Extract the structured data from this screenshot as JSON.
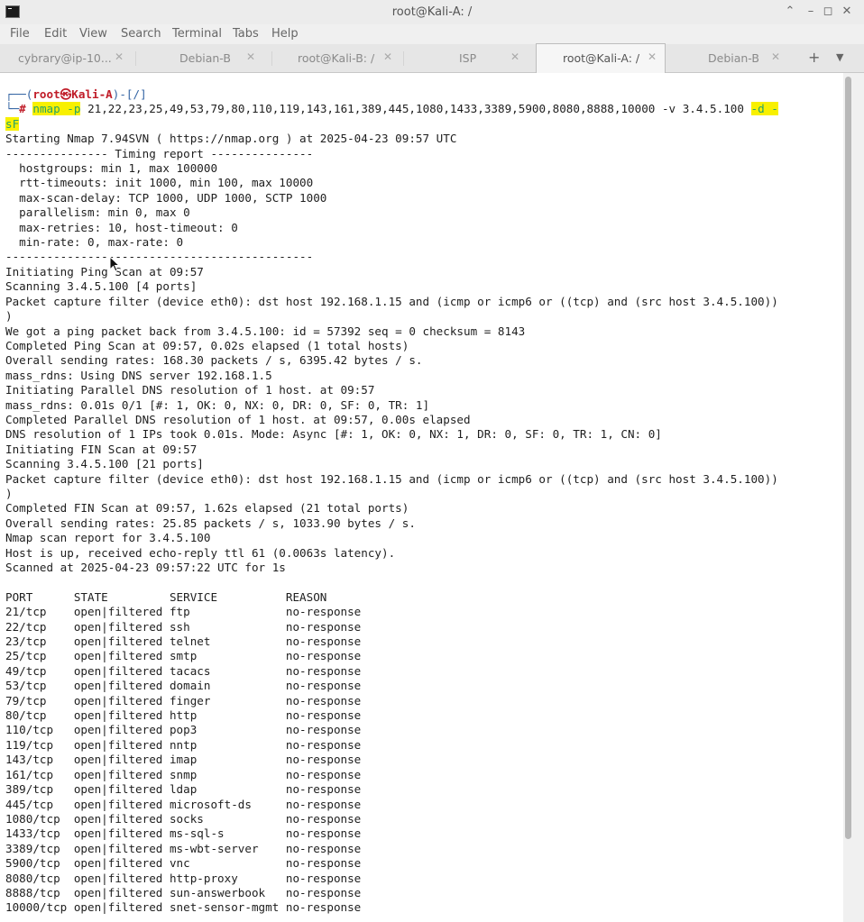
{
  "window": {
    "title": "root@Kali-A: /"
  },
  "menu": [
    "File",
    "Edit",
    "View",
    "Search",
    "Terminal",
    "Tabs",
    "Help"
  ],
  "tabs": [
    {
      "label": "cybrary@ip-10...",
      "active": false
    },
    {
      "label": "Debian-B",
      "active": false
    },
    {
      "label": "root@Kali-B: /",
      "active": false
    },
    {
      "label": "ISP",
      "active": false
    },
    {
      "label": "root@Kali-A: /",
      "active": true
    },
    {
      "label": "Debian-B",
      "active": false
    }
  ],
  "terminal": {
    "prompt": {
      "line1_prefix": "┌──(",
      "user_host": "root㉿Kali-A",
      "line1_suffix": ")-[/]",
      "line2_prefix": "└─",
      "hash": "#",
      "cmd_name": "nmap",
      "cmd_flag": "-p",
      "cmd_args": "21,22,23,25,49,53,79,80,110,119,143,161,389,445,1080,1433,3389,5900,8080,8888,10000 -v 3.4.5.100",
      "cmd_tail1": "-d -",
      "cmd_tail2": "sF"
    },
    "output": "Starting Nmap 7.94SVN ( https://nmap.org ) at 2025-04-23 09:57 UTC\n--------------- Timing report ---------------\n  hostgroups: min 1, max 100000\n  rtt-timeouts: init 1000, min 100, max 10000\n  max-scan-delay: TCP 1000, UDP 1000, SCTP 1000\n  parallelism: min 0, max 0\n  max-retries: 10, host-timeout: 0\n  min-rate: 0, max-rate: 0\n---------------------------------------------\nInitiating Ping Scan at 09:57\nScanning 3.4.5.100 [4 ports]\nPacket capture filter (device eth0): dst host 192.168.1.15 and (icmp or icmp6 or ((tcp) and (src host 3.4.5.100))\n)\nWe got a ping packet back from 3.4.5.100: id = 57392 seq = 0 checksum = 8143\nCompleted Ping Scan at 09:57, 0.02s elapsed (1 total hosts)\nOverall sending rates: 168.30 packets / s, 6395.42 bytes / s.\nmass_rdns: Using DNS server 192.168.1.5\nInitiating Parallel DNS resolution of 1 host. at 09:57\nmass_rdns: 0.01s 0/1 [#: 1, OK: 0, NX: 0, DR: 0, SF: 0, TR: 1]\nCompleted Parallel DNS resolution of 1 host. at 09:57, 0.00s elapsed\nDNS resolution of 1 IPs took 0.01s. Mode: Async [#: 1, OK: 0, NX: 1, DR: 0, SF: 0, TR: 1, CN: 0]\nInitiating FIN Scan at 09:57\nScanning 3.4.5.100 [21 ports]\nPacket capture filter (device eth0): dst host 192.168.1.15 and (icmp or icmp6 or ((tcp) and (src host 3.4.5.100))\n)\nCompleted FIN Scan at 09:57, 1.62s elapsed (21 total ports)\nOverall sending rates: 25.85 packets / s, 1033.90 bytes / s.\nNmap scan report for 3.4.5.100\nHost is up, received echo-reply ttl 61 (0.0063s latency).\nScanned at 2025-04-23 09:57:22 UTC for 1s\n\nPORT      STATE         SERVICE          REASON\n21/tcp    open|filtered ftp              no-response\n22/tcp    open|filtered ssh              no-response\n23/tcp    open|filtered telnet           no-response\n25/tcp    open|filtered smtp             no-response\n49/tcp    open|filtered tacacs           no-response\n53/tcp    open|filtered domain           no-response\n79/tcp    open|filtered finger           no-response\n80/tcp    open|filtered http             no-response\n110/tcp   open|filtered pop3             no-response\n119/tcp   open|filtered nntp             no-response\n143/tcp   open|filtered imap             no-response\n161/tcp   open|filtered snmp             no-response\n389/tcp   open|filtered ldap             no-response\n445/tcp   open|filtered microsoft-ds     no-response\n1080/tcp  open|filtered socks            no-response\n1433/tcp  open|filtered ms-sql-s         no-response\n3389/tcp  open|filtered ms-wbt-server    no-response\n5900/tcp  open|filtered vnc              no-response\n8080/tcp  open|filtered http-proxy       no-response\n8888/tcp  open|filtered sun-answerbook   no-response\n10000/tcp open|filtered snet-sensor-mgmt no-response"
  }
}
